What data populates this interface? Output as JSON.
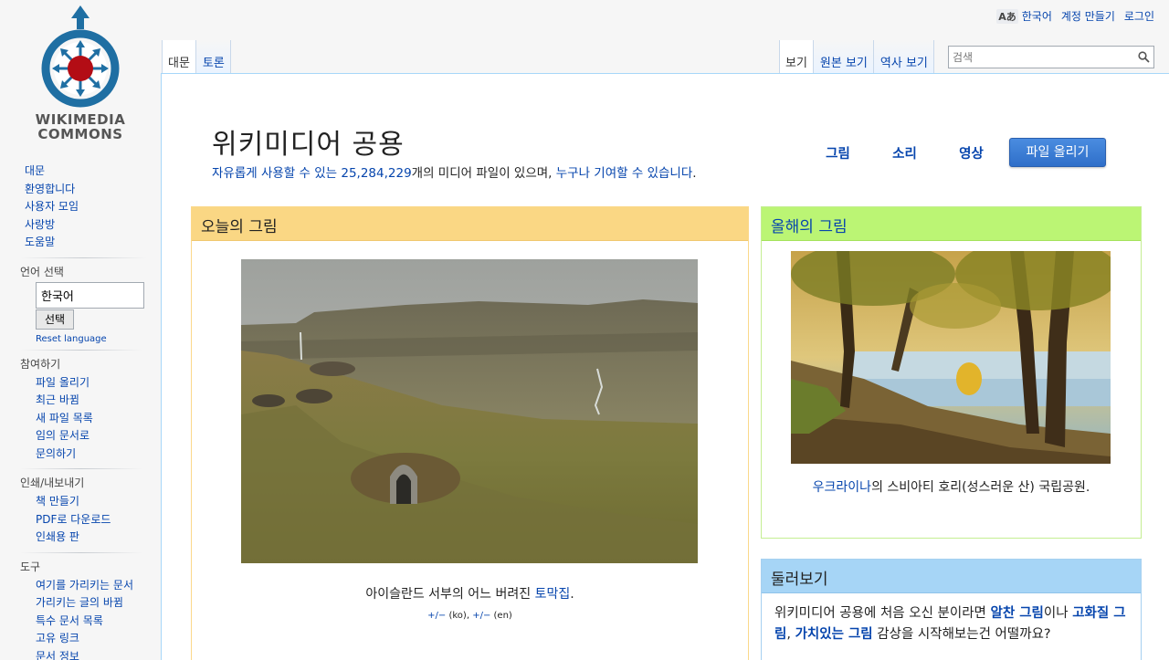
{
  "logo": {
    "line1": "WIKIMEDIA",
    "line2": "COMMONS"
  },
  "personal": {
    "uls_icon": "Aあ",
    "language": "한국어",
    "create_account": "계정 만들기",
    "login": "로그인"
  },
  "tabs_left": [
    {
      "label": "대문",
      "selected": true
    },
    {
      "label": "토론",
      "selected": false
    }
  ],
  "tabs_right": [
    {
      "label": "보기",
      "selected": true
    },
    {
      "label": "원본 보기",
      "selected": false
    },
    {
      "label": "역사 보기",
      "selected": false
    }
  ],
  "search": {
    "placeholder": "검색",
    "value": ""
  },
  "sidebar": {
    "nav": [
      "대문",
      "환영합니다",
      "사용자 모임",
      "사랑방",
      "도움말"
    ],
    "language": {
      "heading": "언어 선택",
      "value": "한국어",
      "button": "선택",
      "reset": "Reset language"
    },
    "participate": {
      "heading": "참여하기",
      "items": [
        "파일 올리기",
        "최근 바뀜",
        "새 파일 목록",
        "임의 문서로",
        "문의하기"
      ]
    },
    "print": {
      "heading": "인쇄/내보내기",
      "items": [
        "책 만들기",
        "PDF로 다운로드",
        "인쇄용 판"
      ]
    },
    "tools": {
      "heading": "도구",
      "items": [
        "여기를 가리키는 문서",
        "가리키는 글의 바뀜",
        "특수 문서 목록",
        "고유 링크",
        "문서 정보"
      ]
    }
  },
  "main": {
    "title": "위키미디어 공용",
    "subtitle": {
      "part1": "자유롭게 사용할 수 있는 ",
      "count": "25,284,229",
      "part2": "개의 미디어 파일이 있으며, ",
      "link": "누구나 기여할 수 있습니다",
      "end": "."
    },
    "quick_links": [
      "그림",
      "소리",
      "영상"
    ],
    "upload_button": "파일 올리기",
    "potd": {
      "heading": "오늘의 그림",
      "caption_text": "아이슬란드 서부의 어느 버려진 ",
      "caption_link": "토막집",
      "caption_end": ".",
      "versions": {
        "link1": "+/−",
        "lang1": " (ko), ",
        "link2": "+/−",
        "lang2": " (en)"
      }
    },
    "poty": {
      "heading": "올해의 그림",
      "caption_link": "우크라이나",
      "caption_text": "의 스비아티 호리(성스러운 산) 국립공원."
    },
    "browse": {
      "heading": "둘러보기",
      "text1": "위키미디어 공용에 처음 오신 분이라면 ",
      "link1": "알찬 그림",
      "text2": "이나 ",
      "link2": "고화질 그림",
      "text3": ", ",
      "link3": "가치있는 그림",
      "text4": " 감상을 시작해보는건 어떨까요?"
    }
  },
  "colors": {
    "link": "#0645ad",
    "potd_header": "#fad784",
    "poty_header": "#bbf574",
    "browse_header": "#a6d5f6",
    "upload_button": "#3b7ed6"
  }
}
